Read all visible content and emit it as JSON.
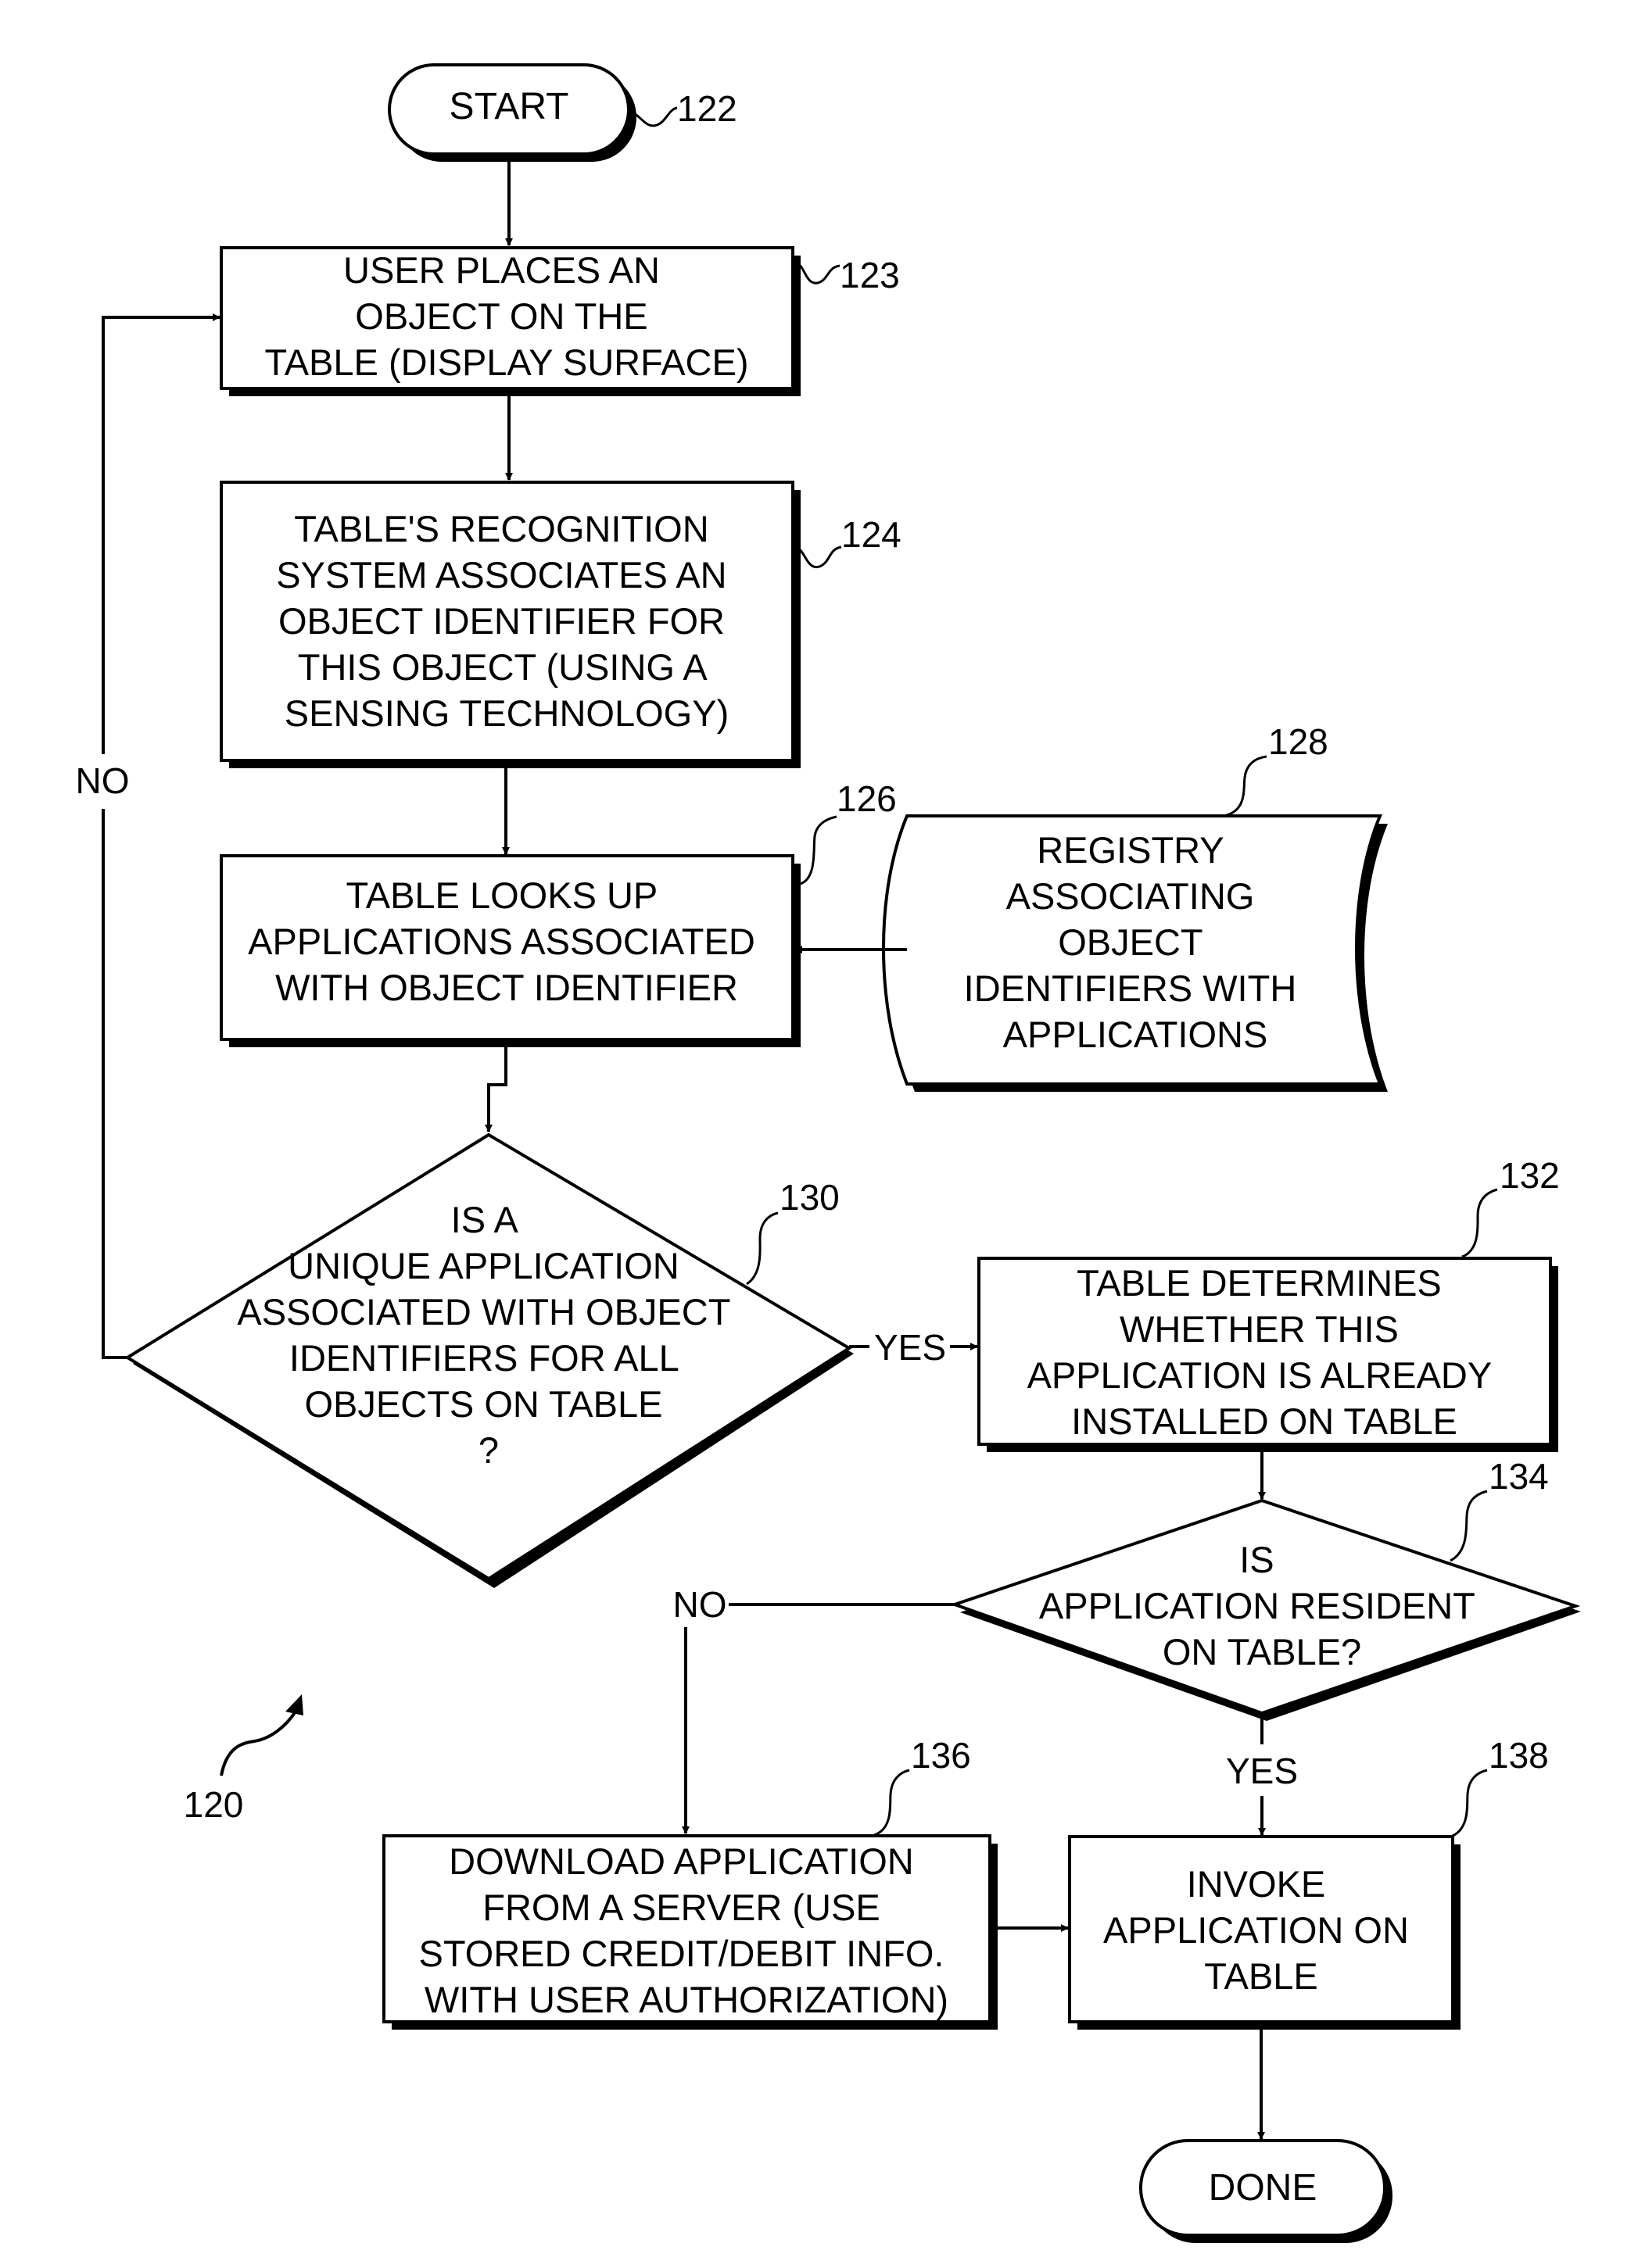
{
  "figure": {
    "figure_ref": "120"
  },
  "nodes": {
    "start": {
      "ref": "122",
      "label": "START"
    },
    "place_object": {
      "ref": "123",
      "lines": [
        "USER PLACES AN",
        "OBJECT ON THE",
        "TABLE (DISPLAY SURFACE)"
      ]
    },
    "recognize": {
      "ref": "124",
      "lines": [
        "TABLE'S RECOGNITION",
        "SYSTEM ASSOCIATES AN",
        "OBJECT IDENTIFIER FOR",
        "THIS OBJECT (USING A",
        "SENSING TECHNOLOGY)"
      ]
    },
    "lookup": {
      "ref": "126",
      "lines": [
        "TABLE LOOKS UP",
        "APPLICATIONS ASSOCIATED",
        "WITH OBJECT IDENTIFIER"
      ]
    },
    "registry": {
      "ref": "128",
      "lines": [
        "REGISTRY",
        "ASSOCIATING",
        "OBJECT",
        "IDENTIFIERS WITH",
        "APPLICATIONS"
      ]
    },
    "unique_app": {
      "ref": "130",
      "lines": [
        "IS A",
        "UNIQUE APPLICATION",
        "ASSOCIATED WITH OBJECT",
        "IDENTIFIERS FOR ALL",
        "OBJECTS ON TABLE",
        "?"
      ]
    },
    "determine_installed": {
      "ref": "132",
      "lines": [
        "TABLE DETERMINES",
        "WHETHER THIS",
        "APPLICATION IS ALREADY",
        "INSTALLED ON TABLE"
      ]
    },
    "is_resident": {
      "ref": "134",
      "lines": [
        "IS",
        "APPLICATION RESIDENT",
        "ON TABLE?"
      ]
    },
    "download": {
      "ref": "136",
      "lines": [
        "DOWNLOAD APPLICATION",
        "FROM A SERVER (USE",
        "STORED CREDIT/DEBIT INFO.",
        "WITH USER AUTHORIZATION)"
      ]
    },
    "invoke": {
      "ref": "138",
      "lines": [
        "INVOKE",
        "APPLICATION ON",
        "TABLE"
      ]
    },
    "done": {
      "label": "DONE"
    }
  },
  "edges": {
    "unique_no": "NO",
    "unique_yes": "YES",
    "resident_no": "NO",
    "resident_yes": "YES"
  }
}
